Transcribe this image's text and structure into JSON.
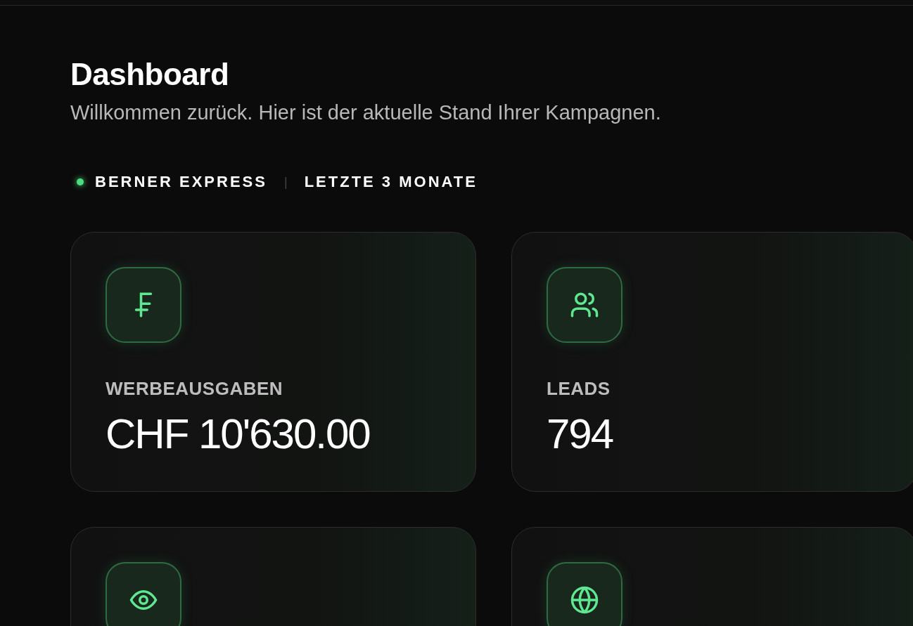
{
  "header": {
    "title": "Dashboard",
    "subtitle": "Willkommen zurück. Hier ist der aktuelle Stand Ihrer Kampagnen."
  },
  "filter": {
    "client": "BERNER EXPRESS",
    "separator": "|",
    "period": "LETZTE 3 MONATE"
  },
  "cards": [
    {
      "kind": "metric",
      "label": "WERBEAUSGABEN",
      "value": "CHF 10'630.00"
    },
    {
      "kind": "metric",
      "label": "LEADS",
      "value": "794"
    },
    {
      "kind": "metric"
    },
    {
      "kind": "metric"
    }
  ]
}
